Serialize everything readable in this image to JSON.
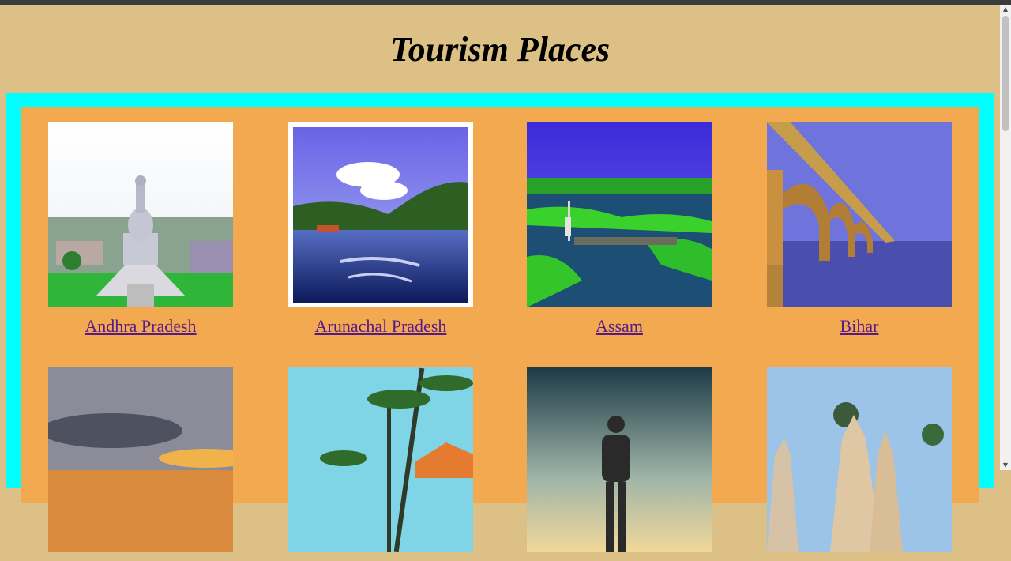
{
  "page": {
    "title": "Tourism Places"
  },
  "places": [
    {
      "label": "Andhra Pradesh"
    },
    {
      "label": "Arunachal Pradesh"
    },
    {
      "label": "Assam"
    },
    {
      "label": "Bihar"
    },
    {
      "label": ""
    },
    {
      "label": ""
    },
    {
      "label": ""
    },
    {
      "label": ""
    }
  ],
  "colors": {
    "page_bg": "#dcc085",
    "frame": "#00ffff",
    "panel": "#f2a94f",
    "link": "#551a8b"
  },
  "icons": {
    "scroll_up": "▲",
    "scroll_down": "▼"
  }
}
